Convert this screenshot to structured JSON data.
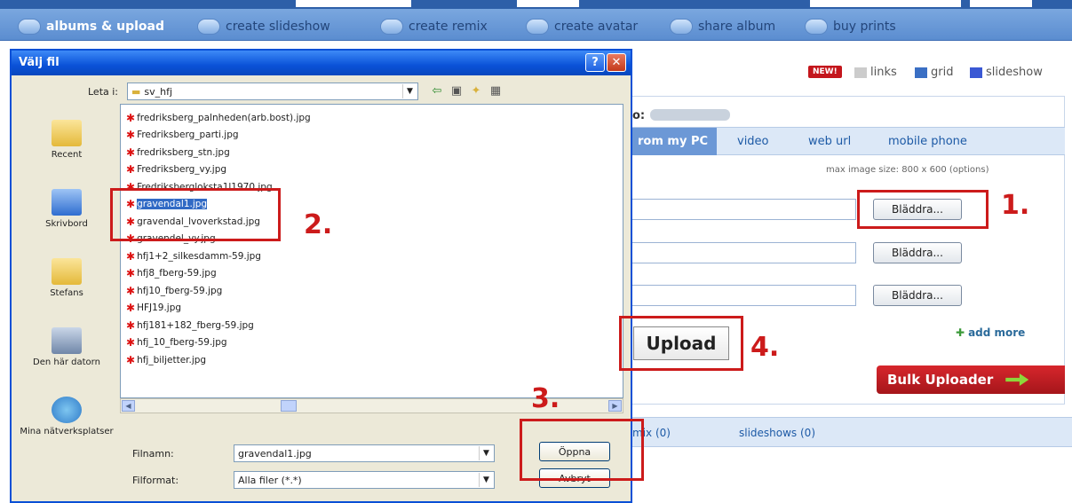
{
  "site": {
    "nav": [
      {
        "label": "albums & upload",
        "icon": "albums-icon"
      },
      {
        "label": "create slideshow",
        "icon": "slideshow-icon"
      },
      {
        "label": "create remix",
        "icon": "remix-icon"
      },
      {
        "label": "create avatar",
        "icon": "avatar-icon"
      },
      {
        "label": "share album",
        "icon": "share-icon"
      },
      {
        "label": "buy prints",
        "icon": "prints-icon"
      }
    ],
    "new_badge": "NEW!",
    "view_options": [
      "links",
      "grid",
      "slideshow"
    ],
    "album_label": "o:",
    "upload_tabs": [
      "rom my PC",
      "video",
      "web url",
      "mobile phone"
    ],
    "max_size": "max image size: 800 x 600 (options)",
    "browse_label": "Bläddra...",
    "upload_label": "Upload",
    "add_more": "add more",
    "bulk_label": "Bulk Uploader",
    "bottom_tabs": [
      "mix (0)",
      "slideshows (0)"
    ]
  },
  "dialog": {
    "title": "Välj fil",
    "look_in_label": "Leta i:",
    "folder": "sv_hfj",
    "places": [
      "Recent",
      "Skrivbord",
      "Stefans",
      "Den här datorn",
      "Mina nätverksplatser"
    ],
    "files": [
      "fredriksberg_palnheden(arb.bost).jpg",
      "Fredriksberg_parti.jpg",
      "fredriksberg_stn.jpg",
      "Fredriksberg_vy.jpg",
      "Fredriksbergloksta1l1970.jpg",
      "gravendal1.jpg",
      "gravendal_lvoverkstad.jpg",
      "gravendel_vy.jpg",
      "hfj1+2_silkesdamm-59.jpg",
      "hfj8_fberg-59.jpg",
      "hfj10_fberg-59.jpg",
      "HFJ19.jpg",
      "hfj181+182_fberg-59.jpg",
      "hfj_10_fberg-59.jpg",
      "hfj_biljetter.jpg"
    ],
    "selected_index": 5,
    "filename_label": "Filnamn:",
    "filename_value": "gravendal1.jpg",
    "filetype_label": "Filformat:",
    "filetype_value": "Alla filer (*.*)",
    "open_label": "Öppna",
    "cancel_label": "Avbryt"
  },
  "annotations": [
    "1.",
    "2.",
    "3.",
    "4."
  ],
  "colors": {
    "annotation": "#cc1b1b",
    "nav": "#5b8dd0",
    "dialog_title": "#0a52d8"
  }
}
